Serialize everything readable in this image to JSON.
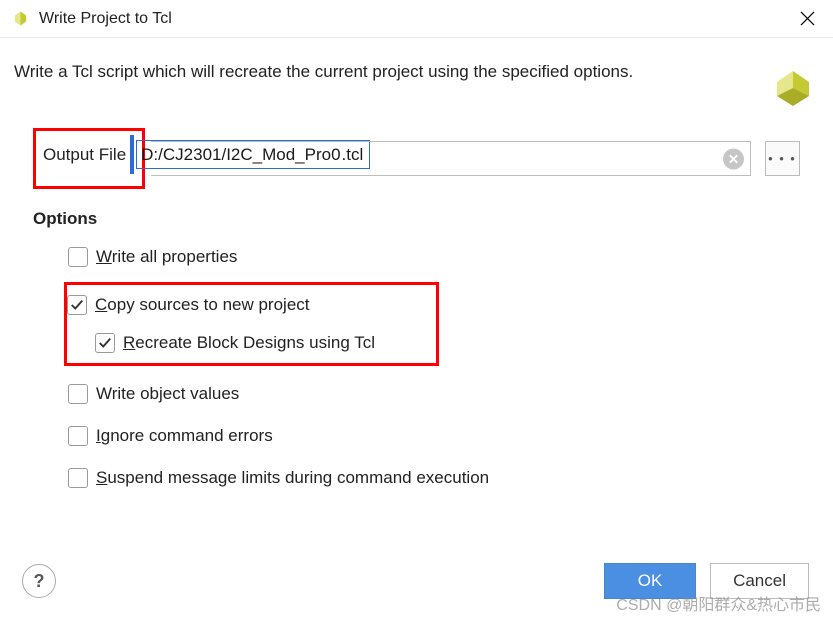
{
  "title": "Write Project to Tcl",
  "description": "Write a Tcl script which will recreate the current project using the specified options.",
  "file": {
    "label": "Output File",
    "value": "D:/CJ2301/I2C_Mod_Pro0.tcl",
    "value_left": "D:/CJ2301/I2C_Mod_Pro0",
    "value_right": ".tcl"
  },
  "options_header": "Options",
  "options": {
    "write_all": {
      "label": "Write all properties",
      "mnemonic": "W",
      "rest": "rite all properties",
      "checked": false
    },
    "copy_sources": {
      "label": "Copy sources to new project",
      "mnemonic": "C",
      "rest": "opy sources to new project",
      "checked": true
    },
    "recreate_bd": {
      "label": "Recreate Block Designs using Tcl",
      "mnemonic": "R",
      "rest": "ecreate Block Designs using Tcl",
      "checked": true
    },
    "write_obj": {
      "label": "Write object values",
      "checked": false
    },
    "ignore_err": {
      "label": "Ignore command errors",
      "mnemonic": "I",
      "rest": "gnore command errors",
      "checked": false
    },
    "suspend": {
      "label": "Suspend message limits during command execution",
      "mnemonic": "S",
      "rest": "uspend message limits during command execution",
      "checked": false
    }
  },
  "buttons": {
    "ok": "OK",
    "cancel": "Cancel",
    "help": "?"
  },
  "watermark": "CSDN @朝阳群众&热心市民"
}
